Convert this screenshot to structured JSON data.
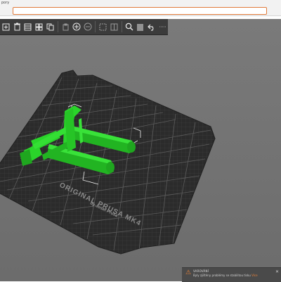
{
  "window": {
    "menu_label": "pory"
  },
  "toolbar": {
    "buttons": [
      {
        "name": "add-button",
        "icon": "add-icon",
        "glyph": "✚"
      },
      {
        "name": "delete-button",
        "icon": "delete-icon",
        "glyph": "🗑"
      },
      {
        "name": "delete-all-button",
        "icon": "delete-all-icon",
        "glyph": "▤"
      },
      {
        "name": "arrange-button",
        "icon": "arrange-icon",
        "glyph": "⊞"
      },
      {
        "name": "copy-button",
        "icon": "copy-icon",
        "glyph": "⎘"
      },
      {
        "name": "paste-button",
        "icon": "paste-icon",
        "glyph": "⎗"
      },
      {
        "name": "add-instance-button",
        "icon": "add-instance-icon",
        "glyph": "⊕"
      },
      {
        "name": "remove-instance-button",
        "icon": "remove-instance-icon",
        "glyph": "⊖"
      },
      {
        "name": "split-objects-button",
        "icon": "split-objects-icon",
        "glyph": "⌬"
      },
      {
        "name": "split-parts-button",
        "icon": "split-parts-icon",
        "glyph": "⊟"
      },
      {
        "name": "search-button",
        "icon": "search-icon",
        "glyph": "🔍"
      },
      {
        "name": "layers-button",
        "icon": "layers-icon",
        "glyph": "≡"
      },
      {
        "name": "undo-button",
        "icon": "undo-icon",
        "glyph": "↶"
      },
      {
        "name": "redo-button",
        "icon": "redo-icon",
        "glyph": "⋯"
      }
    ]
  },
  "bed": {
    "brand_line1": "ORIGINAL PRUSA MK4",
    "brand_line2": "by Josef Prusa"
  },
  "notification": {
    "title": "VAROVÁNÍ",
    "message": "Byly zjištěny problémy se stabilitou tisku",
    "link": "Více",
    "icon": "warning-icon"
  },
  "colors": {
    "object": "#2ad42a",
    "bed": "#2b2b2b",
    "accent": "#e8823a"
  }
}
